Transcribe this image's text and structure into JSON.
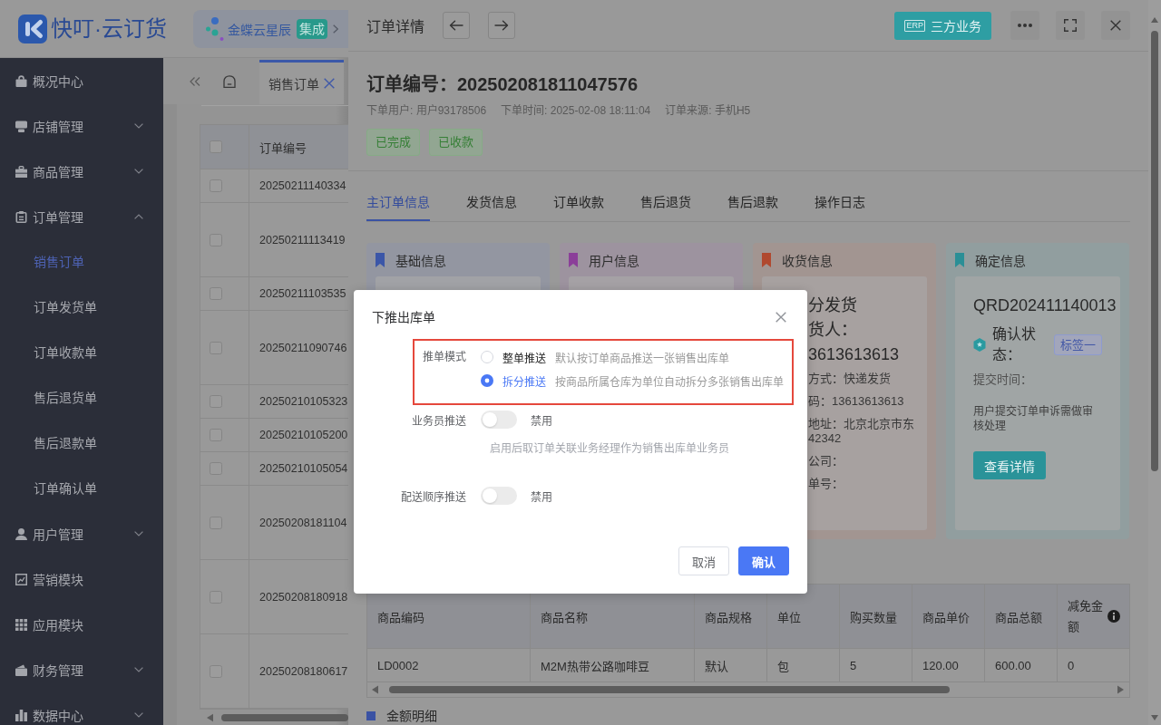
{
  "app": {
    "logo": "快叮·云订货",
    "integration": {
      "name": "金蝶云星辰",
      "badge": "集成"
    }
  },
  "sidebar": {
    "items": [
      {
        "label": "概况中心",
        "kind": "link"
      },
      {
        "label": "店铺管理",
        "kind": "group",
        "expanded": false
      },
      {
        "label": "商品管理",
        "kind": "group",
        "expanded": false
      },
      {
        "label": "订单管理",
        "kind": "group",
        "expanded": true,
        "children": [
          {
            "label": "销售订单",
            "selected": true
          },
          {
            "label": "订单发货单",
            "selected": false
          },
          {
            "label": "订单收款单",
            "selected": false
          },
          {
            "label": "售后退货单",
            "selected": false
          },
          {
            "label": "售后退款单",
            "selected": false
          },
          {
            "label": "订单确认单",
            "selected": false
          }
        ]
      },
      {
        "label": "用户管理",
        "kind": "group",
        "expanded": false
      },
      {
        "label": "营销模块",
        "kind": "link"
      },
      {
        "label": "应用模块",
        "kind": "link"
      },
      {
        "label": "财务管理",
        "kind": "group",
        "expanded": false
      },
      {
        "label": "数据中心",
        "kind": "group",
        "expanded": false
      }
    ]
  },
  "page_tabs": [
    {
      "label": "销售订单",
      "selected": true
    }
  ],
  "order_list": {
    "columns": [
      "订单编号"
    ],
    "all_checked": false,
    "rows": [
      {
        "order_no": "20250211140334",
        "checked": false,
        "kind": "short"
      },
      {
        "order_no": "20250211113419",
        "checked": false,
        "kind": "tall"
      },
      {
        "order_no": "20250211103535",
        "checked": false,
        "kind": "short"
      },
      {
        "order_no": "20250211090746",
        "checked": false,
        "kind": "tall"
      },
      {
        "order_no": "20250210105323",
        "checked": false,
        "kind": "short"
      },
      {
        "order_no": "20250210105200",
        "checked": false,
        "kind": "short"
      },
      {
        "order_no": "20250210105054",
        "checked": false,
        "kind": "short"
      },
      {
        "order_no": "20250208181104",
        "checked": false,
        "kind": "tall"
      },
      {
        "order_no": "20250208180918",
        "checked": false,
        "kind": "tall"
      },
      {
        "order_no": "20250208180617",
        "checked": false,
        "kind": "tall"
      }
    ]
  },
  "drawer": {
    "title": "订单详情",
    "erp_button": {
      "badge": "ERP",
      "label": "三方业务"
    },
    "order": {
      "heading": "订单编号：202502081811047576",
      "meta": [
        "下单用户: 用户93178506",
        "下单时间: 2025-02-08 18:11:04",
        "订单来源: 手机H5"
      ],
      "tags": [
        "已完成",
        "已收款"
      ]
    },
    "tabs": [
      {
        "label": "主订单信息",
        "selected": true
      },
      {
        "label": "发货信息",
        "selected": false
      },
      {
        "label": "订单收款",
        "selected": false
      },
      {
        "label": "售后退货",
        "selected": false
      },
      {
        "label": "售后退款",
        "selected": false
      },
      {
        "label": "操作日志",
        "selected": false
      }
    ],
    "cards": [
      {
        "title": "基础信息",
        "color": "#3b56a8",
        "kind": "covered"
      },
      {
        "title": "用户信息",
        "color": "#8b3f99",
        "kind": "covered"
      },
      {
        "title": "收货信息",
        "color": "#b0492f",
        "kind": "fields",
        "headlines": [
          "分发货",
          "货人：",
          "3613613613"
        ],
        "fields": [
          "方式：快递发货",
          "码：13613613613",
          "地址：北京北京市东42342",
          "公司：",
          "单号："
        ]
      },
      {
        "title": "确定信息",
        "color": "#2b8f96",
        "kind": "confirm",
        "code": "QRD202411140013",
        "status_label": "确认状态：",
        "status_tag": "标签一",
        "time_label": "提交时间：",
        "note": "用户提交订单申诉需做审核处理",
        "button": "查看详情"
      }
    ],
    "products": {
      "columns": [
        {
          "label": "商品编码",
          "info": false
        },
        {
          "label": "商品名称",
          "info": false
        },
        {
          "label": "商品规格",
          "info": false
        },
        {
          "label": "单位",
          "info": false
        },
        {
          "label": "购买数量",
          "info": false
        },
        {
          "label": "商品单价",
          "info": false
        },
        {
          "label": "商品总额",
          "info": false
        },
        {
          "label": "减免金额",
          "info": true
        }
      ],
      "rows": [
        [
          "LD0002",
          "M2M热带公路咖啡豆",
          "默认",
          "包",
          "5",
          "120.00",
          "600.00",
          "0"
        ]
      ]
    },
    "amount_section": "金额明细"
  },
  "dialog": {
    "title": "下推出库单",
    "push_mode": {
      "label": "推单模式",
      "highlighted": true,
      "options": [
        {
          "label": "整单推送",
          "hint": "默认按订单商品推送一张销售出库单",
          "selected": false
        },
        {
          "label": "拆分推送",
          "hint": "按商品所属仓库为单位自动拆分多张销售出库单",
          "selected": true
        }
      ]
    },
    "switches": [
      {
        "label": "业务员推送",
        "on": false,
        "state_text": "禁用",
        "hint": "启用后取订单关联业务经理作为销售出库单业务员"
      },
      {
        "label": "配送顺序推送",
        "on": false,
        "state_text": "禁用"
      }
    ],
    "buttons": [
      {
        "label": "取消",
        "kind": "default"
      },
      {
        "label": "确认",
        "kind": "primary"
      }
    ]
  }
}
